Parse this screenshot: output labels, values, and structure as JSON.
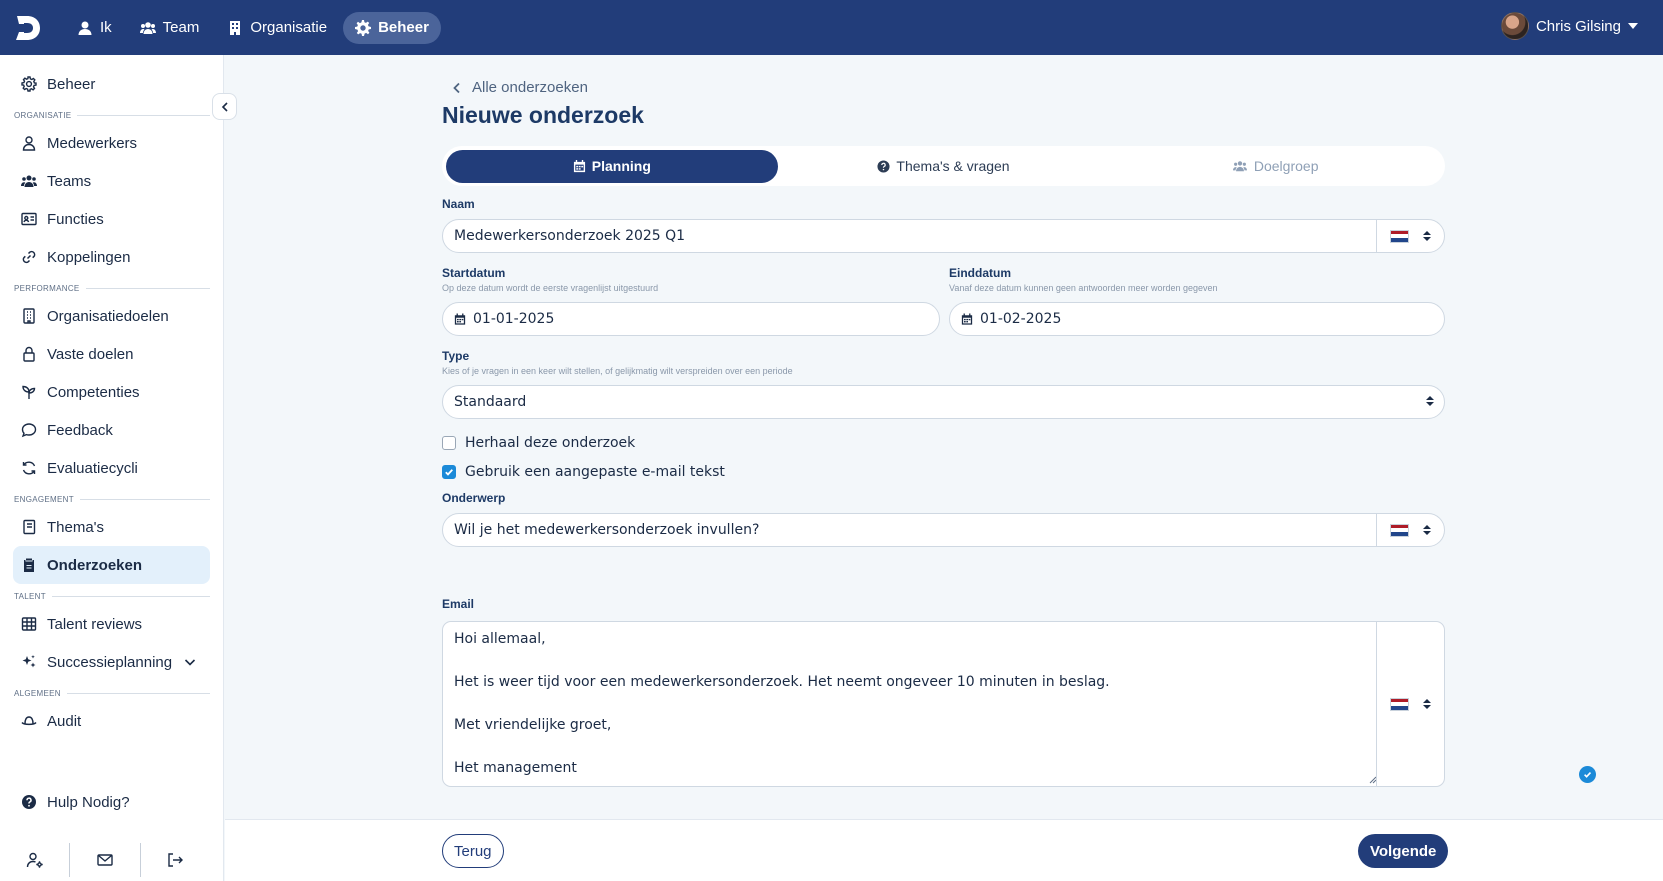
{
  "topbar": {
    "nav": [
      {
        "label": "Ik",
        "icon": "user-icon"
      },
      {
        "label": "Team",
        "icon": "users-icon"
      },
      {
        "label": "Organisatie",
        "icon": "building-icon"
      },
      {
        "label": "Beheer",
        "icon": "gear-icon",
        "active": true
      }
    ],
    "user_name": "Chris Gilsing"
  },
  "sidebar": {
    "top_item": "Beheer",
    "sections": {
      "organisatie": "ORGANISATIE",
      "performance": "PERFORMANCE",
      "engagement": "ENGAGEMENT",
      "talent": "TALENT",
      "algemeen": "ALGEMEEN"
    },
    "items": {
      "medewerkers": "Medewerkers",
      "teams": "Teams",
      "functies": "Functies",
      "koppelingen": "Koppelingen",
      "organisatiedoelen": "Organisatiedoelen",
      "vaste_doelen": "Vaste doelen",
      "competenties": "Competenties",
      "feedback": "Feedback",
      "evaluatiecycli": "Evaluatiecycli",
      "themas": "Thema's",
      "onderzoeken": "Onderzoeken",
      "talent_reviews": "Talent reviews",
      "successieplanning": "Successieplanning",
      "audit": "Audit"
    },
    "help": "Hulp Nodig?"
  },
  "main": {
    "back_link": "Alle onderzoeken",
    "title": "Nieuwe onderzoek",
    "tabs": [
      {
        "label": "Planning",
        "state": "active"
      },
      {
        "label": "Thema's & vragen",
        "state": "normal"
      },
      {
        "label": "Doelgroep",
        "state": "disabled"
      }
    ],
    "form": {
      "naam_label": "Naam",
      "naam_value": "Medewerkersonderzoek 2025 Q1",
      "start_label": "Startdatum",
      "start_hint": "Op deze datum wordt de eerste vragenlijst uitgestuurd",
      "start_value": "01-01-2025",
      "eind_label": "Einddatum",
      "eind_hint": "Vanaf deze datum kunnen geen antwoorden meer worden gegeven",
      "eind_value": "01-02-2025",
      "type_label": "Type",
      "type_hint": "Kies of je vragen in een keer wilt stellen, of gelijkmatig wilt verspreiden over een periode",
      "type_value": "Standaard",
      "repeat_label": "Herhaal deze onderzoek",
      "repeat_checked": false,
      "custom_email_label": "Gebruik een aangepaste e-mail tekst",
      "custom_email_checked": true,
      "onderwerp_label": "Onderwerp",
      "onderwerp_value": "Wil je het medewerkersonderzoek invullen?",
      "email_label": "Email",
      "email_lines": [
        "Hoi allemaal,",
        "",
        "Het is weer tijd voor een medewerkersonderzoek. Het neemt ongeveer 10 minuten in beslag.",
        "",
        "Met vriendelijke groet,",
        "",
        "Het management"
      ]
    },
    "footer": {
      "back": "Terug",
      "next": "Volgende"
    }
  },
  "colors": {
    "brand": "#223d7a",
    "accent": "#1b8ad8",
    "active_bg": "#e3f0fb"
  }
}
